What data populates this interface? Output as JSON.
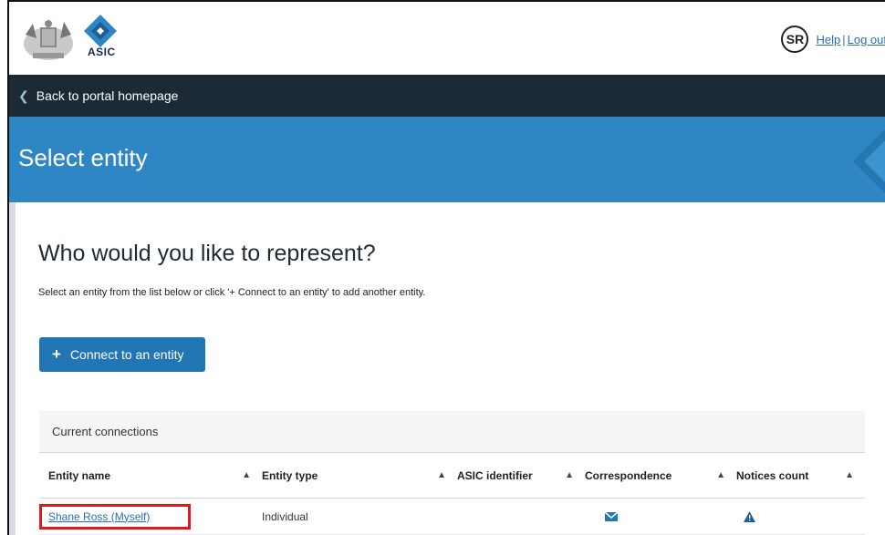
{
  "header": {
    "logo_text": "ASIC",
    "user_initials": "SR",
    "help_label": "Help",
    "logout_label": "Log out",
    "link_separator": "|"
  },
  "nav": {
    "back_label": "Back to portal homepage"
  },
  "hero": {
    "title": "Select entity"
  },
  "main": {
    "heading": "Who would you like to represent?",
    "instructions": "Select an entity from the list below or click '+ Connect to an entity' to add another entity.",
    "connect_button_label": "Connect to an entity"
  },
  "table": {
    "caption": "Current connections",
    "columns": [
      "Entity name",
      "Entity type",
      "ASIC identifier",
      "Correspondence",
      "Notices count"
    ],
    "rows": [
      {
        "entity_name": "Shane Ross (Myself)",
        "entity_type": "Individual",
        "asic_identifier": "",
        "correspondence_icon": "envelope-icon",
        "notices_icon": "warning-icon"
      }
    ]
  },
  "colors": {
    "nav_bg": "#1c2a36",
    "hero_bg": "#2f86c4",
    "button_bg": "#2176b3",
    "link": "#2a6ebb",
    "highlight": "#e0191e"
  }
}
